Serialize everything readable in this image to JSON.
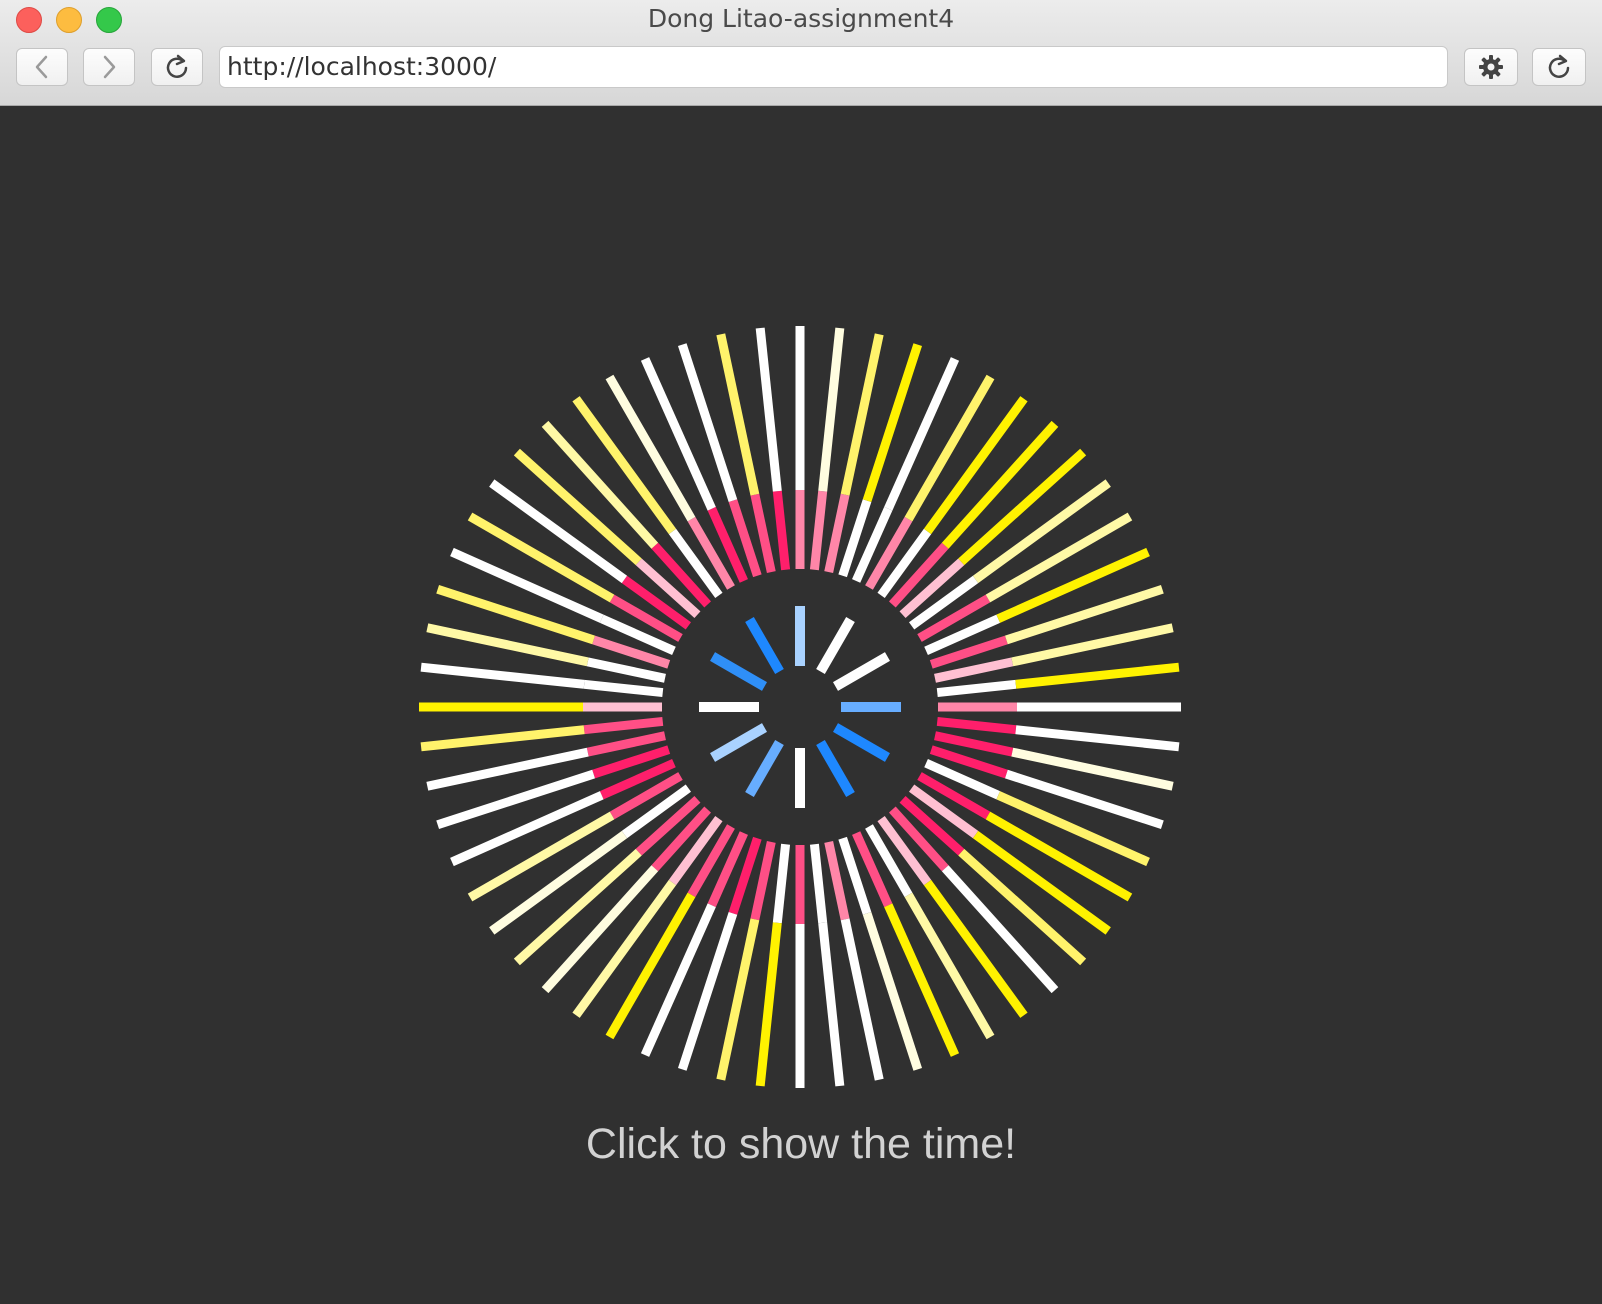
{
  "window": {
    "title": "Dong Litao-assignment4"
  },
  "toolbar": {
    "url": "http://localhost:3000/",
    "back_icon": "chevron-left-icon",
    "forward_icon": "chevron-right-icon",
    "reload_icon": "reload-icon",
    "settings_icon": "gear-icon"
  },
  "page": {
    "caption": "Click to show the time!"
  },
  "colors": {
    "background": "#303030",
    "outer_ring": [
      "#fff200",
      "#fff36b",
      "#fff9a6",
      "#fffde0",
      "#ffffff"
    ],
    "middle_ring": [
      "#ff1f6b",
      "#ff4f86",
      "#ff86a8",
      "#ffc0d2",
      "#ffffff"
    ],
    "inner_ring": [
      "#1e88ff",
      "#2f8ff7",
      "#67adff",
      "#a9d2ff",
      "#ffffff"
    ]
  },
  "visual": {
    "outer_spoke_count": 60,
    "inner_spoke_count": 12
  }
}
